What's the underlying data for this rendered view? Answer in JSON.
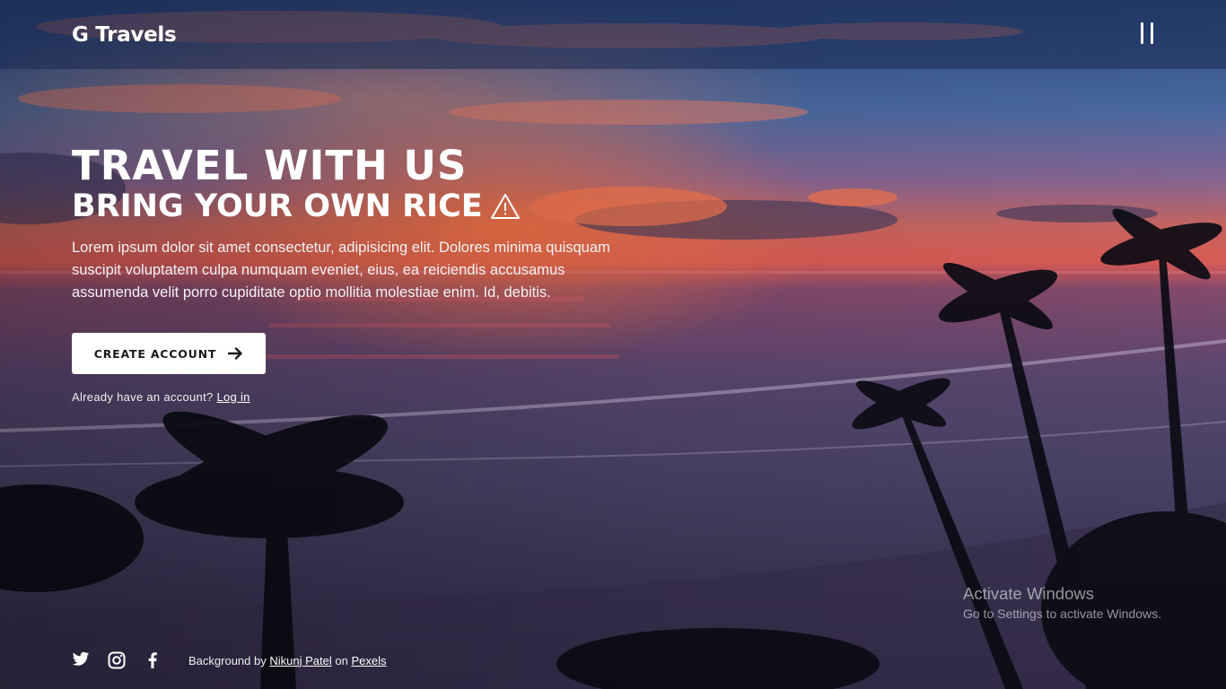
{
  "header": {
    "brand": "G Travels",
    "menu_icon": "menu-bars-icon"
  },
  "hero": {
    "title": "TRAVEL WITH US",
    "subtitle": "BRING YOUR OWN RICE",
    "subtitle_icon": "warning-triangle-icon",
    "description": "Lorem ipsum dolor sit amet consectetur, adipisicing elit. Dolores minima quisquam suscipit voluptatem culpa numquam eveniet, eius, ea reiciendis accusamus assumenda velit porro cupiditate optio mollitia molestiae enim. Id, debitis.",
    "cta_label": "CREATE ACCOUNT",
    "cta_icon": "arrow-right-icon",
    "login_prompt": "Already have an account?",
    "login_link": "Log in"
  },
  "footer": {
    "social": [
      {
        "name": "twitter",
        "icon": "twitter-icon"
      },
      {
        "name": "instagram",
        "icon": "instagram-icon"
      },
      {
        "name": "facebook",
        "icon": "facebook-icon"
      }
    ],
    "credit_prefix": "Background by",
    "credit_author": "Nikunj Patel",
    "credit_middle": "on",
    "credit_source": "Pexels"
  },
  "watermark": {
    "title": "Activate Windows",
    "subtitle": "Go to Settings to activate Windows."
  },
  "colors": {
    "header_bg": "#1c2a55",
    "button_bg": "#ffffff",
    "button_text": "#1a1a1a",
    "text": "#ffffff"
  }
}
